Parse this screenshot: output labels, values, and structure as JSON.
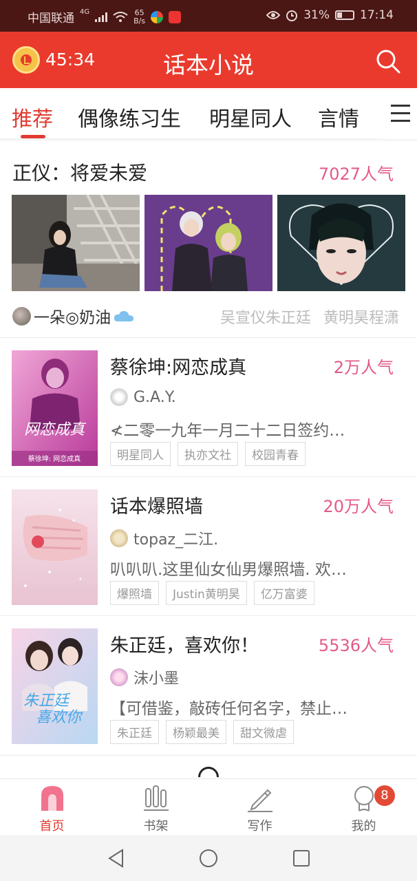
{
  "status_bar": {
    "carrier": "中国联通",
    "network": "4G",
    "speed_value": "65",
    "speed_unit": "B/s",
    "battery": "31%",
    "time": "17:14"
  },
  "header": {
    "timer": "45:34",
    "title": "话本小说"
  },
  "tabs": [
    "推荐",
    "偶像练习生",
    "明星同人",
    "言情"
  ],
  "featured": {
    "title": "正仪：将爱未爱",
    "popularity": "7027人气",
    "author": "一朵◎奶油",
    "tags": [
      "吴宣仪朱正廷",
      "黄明昊程潇"
    ]
  },
  "books": [
    {
      "title": "蔡徐坤:网恋成真",
      "popularity": "2万人气",
      "author": "G.A.Y.",
      "description": "≮二零一九年一月二十二日签约…",
      "tags": [
        "明星同人",
        "执亦文社",
        "校园青春"
      ],
      "cover_text": "蔡徐坤: 网恋成真"
    },
    {
      "title": "话本爆照墙",
      "popularity": "20万人气",
      "author": "topaz_二江.",
      "description": "叭叭叭.这里仙女仙男爆照墙. 欢…",
      "tags": [
        "爆照墙",
        "Justin黄明昊",
        "亿万富婆"
      ]
    },
    {
      "title": "朱正廷，喜欢你！",
      "popularity": "5536人气",
      "author": "沫小墨",
      "description": "【可借鉴，敲砖任何名字，禁止…",
      "tags": [
        "朱正廷",
        "杨颖最美",
        "甜文微虐"
      ]
    }
  ],
  "bottom_nav": {
    "items": [
      "首页",
      "书架",
      "写作",
      "我的"
    ],
    "active": "首页",
    "badge": "8"
  },
  "colors": {
    "brand_red": "#ea3a2d",
    "popularity_pink": "#e45a8a",
    "status_bar_bg": "#4a1714"
  }
}
